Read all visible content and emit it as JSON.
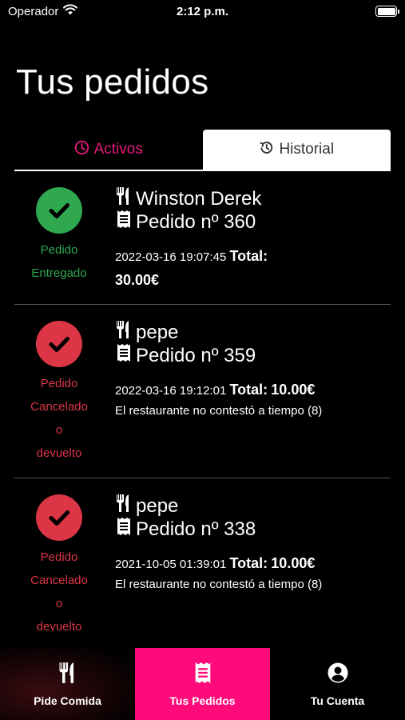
{
  "status_bar": {
    "carrier": "Operador",
    "time": "2:12 p.m."
  },
  "page": {
    "title": "Tus pedidos"
  },
  "tabs": [
    {
      "label": "Activos",
      "icon": "clock-icon",
      "color": "#e8197d"
    },
    {
      "label": "Historial",
      "icon": "history-icon",
      "selected": true
    }
  ],
  "orders": [
    {
      "status_lines": [
        "Pedido",
        "Entregado"
      ],
      "status_color": "#2fa84f",
      "restaurant": "Winston Derek",
      "order_label": "Pedido nº 360",
      "datetime": "2022-03-16 19:07:45",
      "total_label": "Total:",
      "total": "30.00€",
      "note": ""
    },
    {
      "status_lines": [
        "Pedido",
        "Cancelado",
        "o",
        "devuelto"
      ],
      "status_color": "#dc3545",
      "restaurant": "pepe",
      "order_label": "Pedido nº 359",
      "datetime": "2022-03-16 19:12:01",
      "total_label": "Total:",
      "total": "10.00€",
      "note": "El restaurante no contestó a tiempo (8)"
    },
    {
      "status_lines": [
        "Pedido",
        "Cancelado",
        "o",
        "devuelto"
      ],
      "status_color": "#dc3545",
      "restaurant": "pepe",
      "order_label": "Pedido nº 338",
      "datetime": "2021-10-05 01:39:01",
      "total_label": "Total:",
      "total": "10.00€",
      "note": "El restaurante no contestó a tiempo (8)"
    }
  ],
  "bottom_nav": [
    {
      "label": "Pide Comida",
      "icon": "cutlery-icon"
    },
    {
      "label": "Tus Pedidos",
      "icon": "receipt-icon",
      "selected": true,
      "color": "#ff0a7a"
    },
    {
      "label": "Tu Cuenta",
      "icon": "account-icon"
    }
  ]
}
